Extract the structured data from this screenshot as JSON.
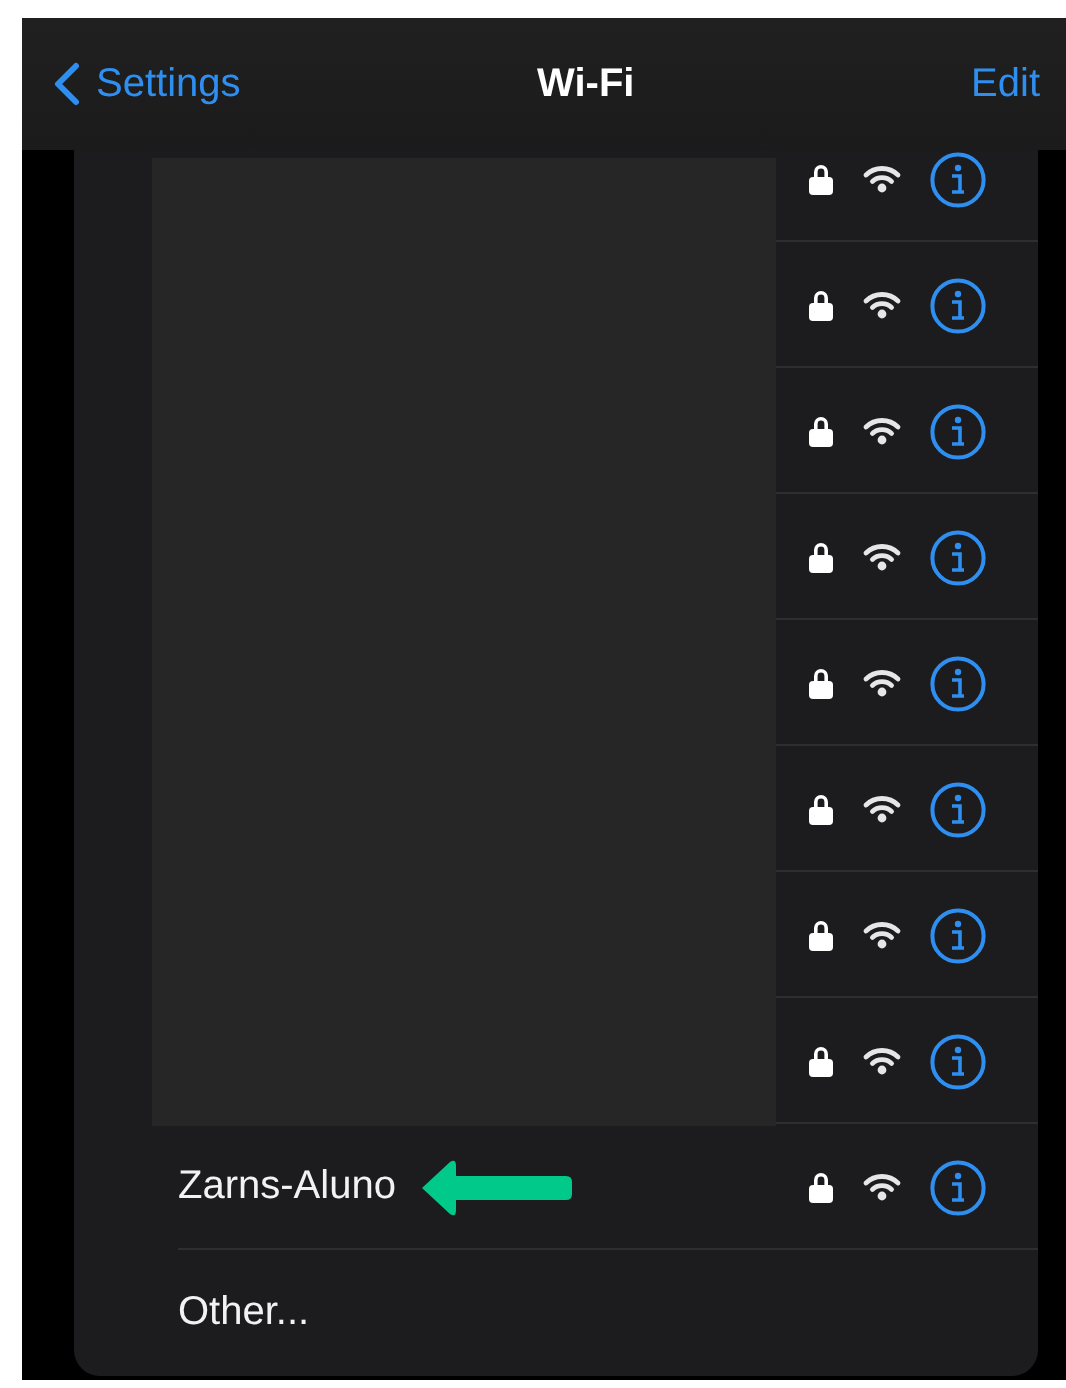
{
  "nav": {
    "back": "Settings",
    "title": "Wi-Fi",
    "action": "Edit"
  },
  "networks": [
    {
      "locked": true
    },
    {
      "locked": true
    },
    {
      "locked": true
    },
    {
      "locked": true
    },
    {
      "locked": true
    },
    {
      "locked": true
    },
    {
      "locked": true
    },
    {
      "locked": true
    },
    {
      "name": "Zarns-Aluno",
      "locked": true,
      "highlighted": true
    }
  ],
  "other": "Other..."
}
